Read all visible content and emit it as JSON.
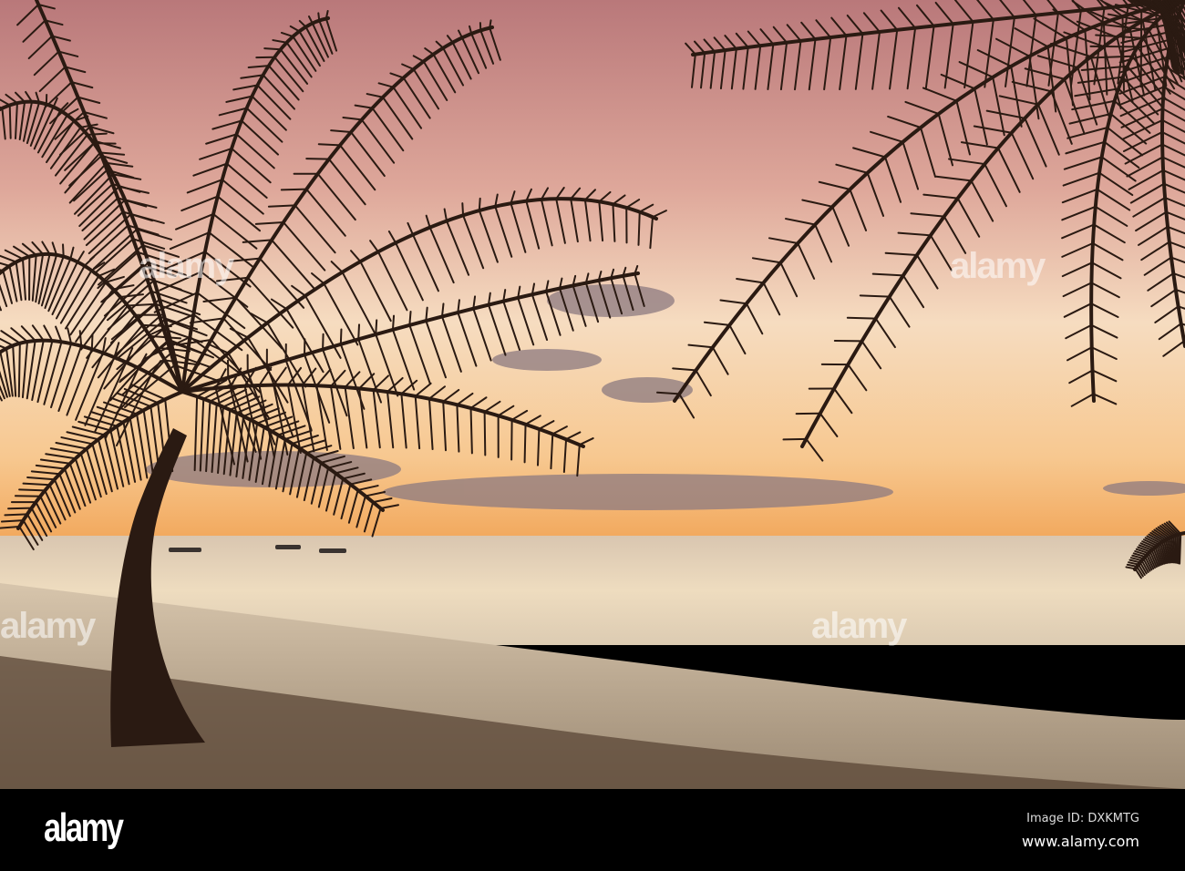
{
  "photo": {
    "subject": "palm trees silhouetted at sunset over beach and sea",
    "colors": {
      "sky_top": "#b9787a",
      "sky_mid": "#f0c9a8",
      "horizon": "#f5b86a",
      "sea": "#e9d7b8",
      "sand": "#cdb9a0",
      "grass": "#3a2c22",
      "silhouette": "#2a1a12"
    }
  },
  "watermark": {
    "logo": "alamy"
  },
  "footer": {
    "logo": "alamy",
    "image_id": "Image ID: DXKMTG",
    "url": "www.alamy.com"
  }
}
